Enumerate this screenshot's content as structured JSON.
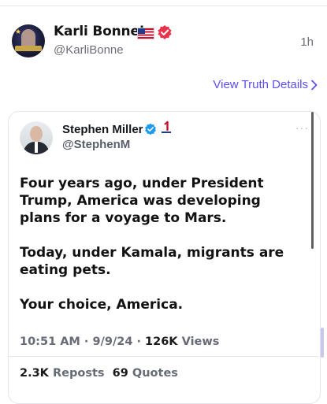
{
  "post": {
    "name": "Karli Bonne’",
    "handle": "@KarliBonne",
    "time": "1h",
    "view_details_label": "View Truth Details"
  },
  "quote": {
    "name": "Stephen Miller",
    "handle": "@StephenM",
    "paragraphs": [
      "Four years ago, under President Trump, America was developing plans for a voyage to Mars.",
      "Today, under Kamala, migrants are eating pets.",
      "Your choice, America."
    ],
    "time": "10:51 AM",
    "date": "9/9/24",
    "views_count": "126K",
    "views_label": "Views",
    "reposts_count": "2.3K",
    "reposts_label": "Reposts",
    "quotes_count": "69",
    "quotes_label": "Quotes",
    "more_label": "···"
  },
  "icons": {
    "flag": "us-flag-icon",
    "red_badge": "red-verified-badge-icon",
    "verified": "blue-verified-icon",
    "one_badge": "number-one-badge-icon",
    "chevron": "chevron-right-icon",
    "more": "more-icon"
  },
  "colors": {
    "link": "#5a4ff0",
    "red_badge": "#e8334b",
    "verified_blue": "#1d9bf0",
    "meta_gray": "#666b75"
  }
}
